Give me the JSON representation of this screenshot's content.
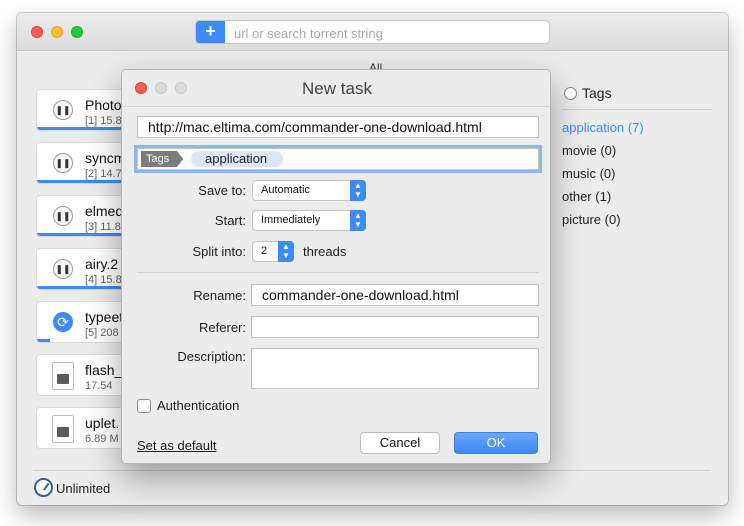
{
  "toolbar": {
    "add_icon_glyph": "+",
    "url_placeholder": "url or search torrent string",
    "filter_label": "All",
    "filter_arrow": "⌄"
  },
  "downloads": [
    {
      "name": "Photo",
      "meta": "[1] 15.8",
      "state": "pause",
      "progress": 1.0
    },
    {
      "name": "syncm",
      "meta": "[2] 14.7",
      "state": "pause",
      "progress": 1.0
    },
    {
      "name": "elmed",
      "meta": "[3] 11.8",
      "state": "pause",
      "progress": 1.0
    },
    {
      "name": "airy.2",
      "meta": "[4] 15.8",
      "state": "pause",
      "progress": 1.0
    },
    {
      "name": "typeet",
      "meta": "[5] 208",
      "state": "refresh",
      "progress": 0.12
    },
    {
      "name": "flash_",
      "meta": "17.54",
      "state": "file",
      "progress": 0
    },
    {
      "name": "uplet.",
      "meta": "6.89 M",
      "state": "file",
      "progress": 0
    }
  ],
  "icons": {
    "pause": "❚❚",
    "refresh": "⟳"
  },
  "tags_panel": {
    "title": "Tags",
    "items": [
      {
        "label": "application",
        "count": "(7)",
        "active": true
      },
      {
        "label": "movie",
        "count": "(0)",
        "active": false
      },
      {
        "label": "music",
        "count": "(0)",
        "active": false
      },
      {
        "label": "other",
        "count": "(1)",
        "active": false
      },
      {
        "label": "picture",
        "count": "(0)",
        "active": false
      }
    ]
  },
  "footer": {
    "speed_label": "Unlimited"
  },
  "dialog": {
    "title": "New task",
    "url": "http://mac.eltima.com/commander-one-download.html",
    "tags_label": "Tags",
    "tag_chip": "application",
    "save_to_label": "Save to:",
    "save_to_value": "Automatic",
    "start_label": "Start:",
    "start_value": "Immediately",
    "split_label": "Split into:",
    "split_value": "2",
    "threads_label": "threads",
    "rename_label": "Rename:",
    "rename_value": "commander-one-download.html",
    "referer_label": "Referer:",
    "referer_value": "",
    "description_label": "Description:",
    "description_value": "",
    "auth_label": "Authentication",
    "auth_checked": false,
    "set_default_label": "Set as default",
    "cancel_label": "Cancel",
    "ok_label": "OK"
  },
  "colors": {
    "accent": "#3d8bf7",
    "close": "#fd5f57",
    "minimize": "#febc2e",
    "zoom": "#28c840"
  }
}
